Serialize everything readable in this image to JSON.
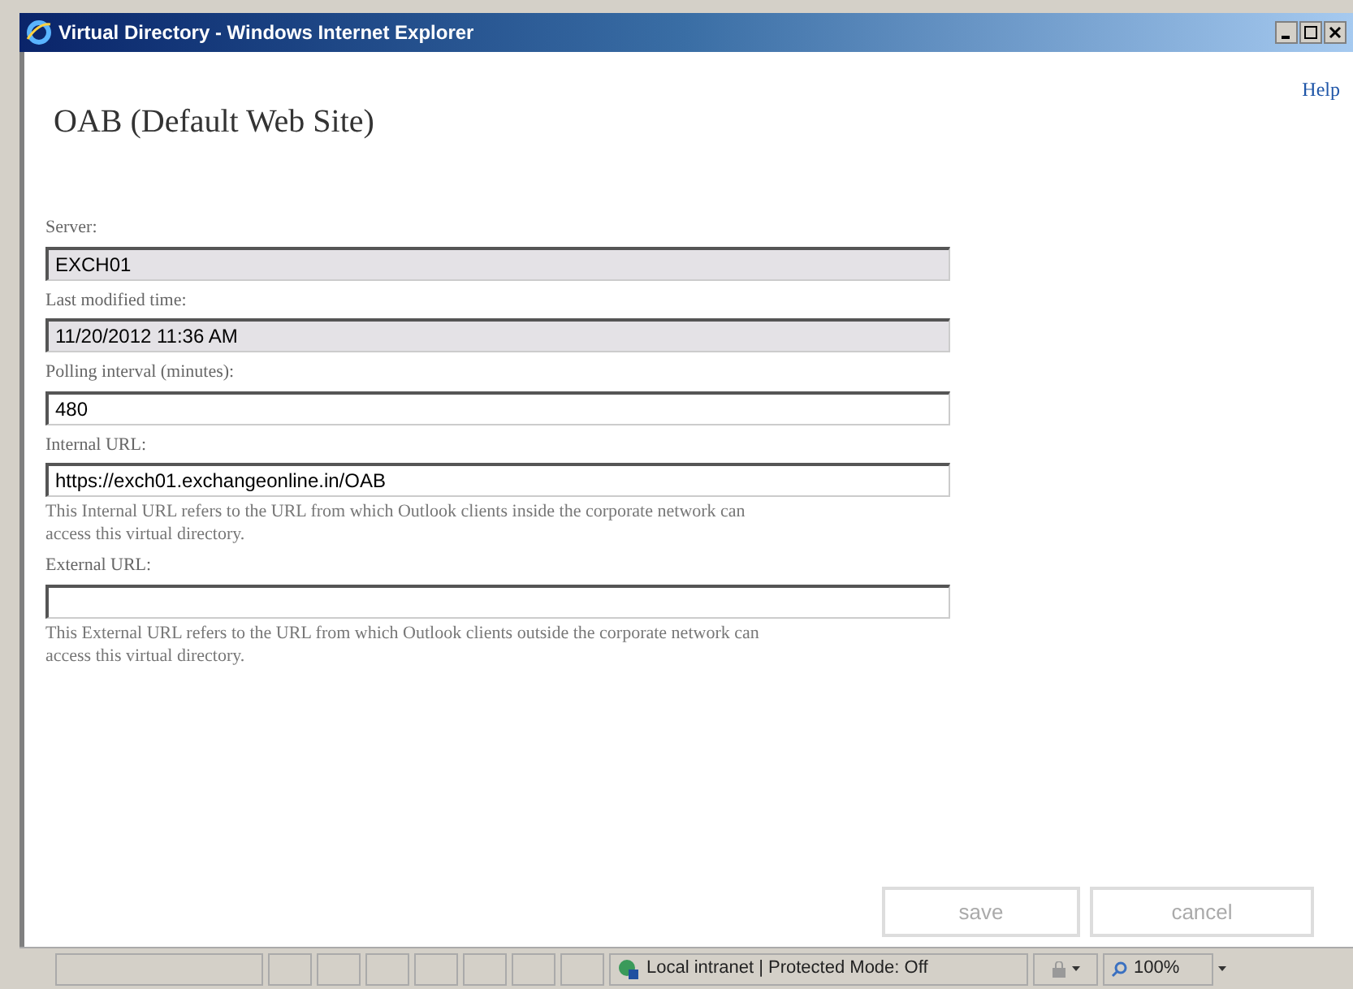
{
  "window": {
    "title": "Virtual Directory - Windows Internet Explorer"
  },
  "help_link": "Help",
  "heading": "OAB (Default Web Site)",
  "fields": [
    {
      "label": "Server:",
      "value": "EXCH01",
      "disabled": true
    },
    {
      "label": "Last modified time:",
      "value": "11/20/2012 11:36 AM",
      "disabled": true
    },
    {
      "label": "Polling interval (minutes):",
      "value": "480",
      "disabled": false
    },
    {
      "label": "Internal URL:",
      "value": "https://exch01.exchangeonline.in/OAB",
      "disabled": false,
      "description": "This Internal URL refers to the URL from which Outlook clients inside the corporate network can access this virtual directory."
    },
    {
      "label": "External URL:",
      "disabled": false,
      "description": "This External URL refers to the URL from which Outlook clients outside the corporate network can access this virtual directory."
    }
  ],
  "buttons": [
    {
      "label": "save",
      "disabled": true
    },
    {
      "label": "cancel",
      "disabled": true
    }
  ],
  "status_bar": {
    "zone": "Local intranet | Protected Mode: Off",
    "zoom": "100%"
  }
}
